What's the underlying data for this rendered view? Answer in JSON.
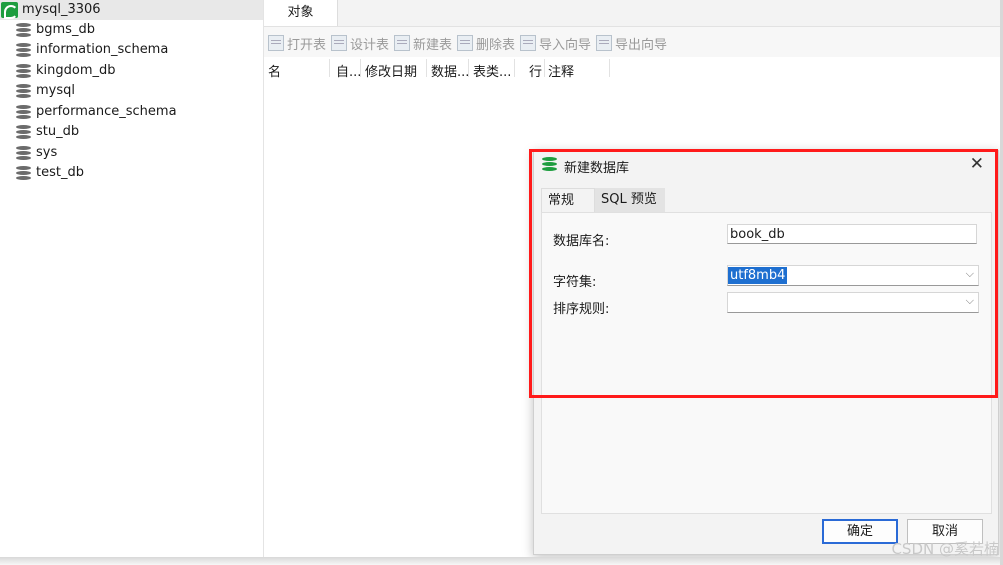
{
  "tree": {
    "connection": "mysql_3306",
    "databases": [
      "bgms_db",
      "information_schema",
      "kingdom_db",
      "mysql",
      "performance_schema",
      "stu_db",
      "sys",
      "test_db"
    ]
  },
  "main": {
    "tab": "对象",
    "toolbar": [
      "打开表",
      "设计表",
      "新建表",
      "删除表",
      "导入向导",
      "导出向导"
    ],
    "columns": [
      "名",
      "自...",
      "修改日期",
      "数据...",
      "表类...",
      "行",
      "注释"
    ]
  },
  "dialog": {
    "title": "新建数据库",
    "tabs": [
      "常规",
      "SQL 预览"
    ],
    "fields": {
      "name_label": "数据库名:",
      "name_value": "book_db",
      "charset_label": "字符集:",
      "charset_value": "utf8mb4",
      "collation_label": "排序规则:",
      "collation_value": ""
    },
    "buttons": {
      "ok": "确定",
      "cancel": "取消"
    }
  },
  "watermark": "CSDN @奚若楠",
  "colors": {
    "highlight": "#ff1a1a",
    "accent": "#1e9d3f",
    "selection": "#1e6fd0"
  }
}
